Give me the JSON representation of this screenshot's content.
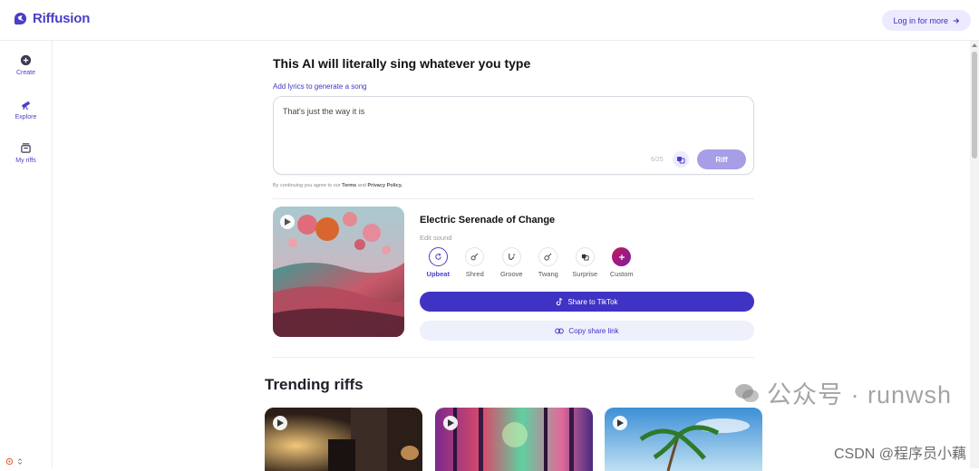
{
  "header": {
    "logo_text": "Riffusion",
    "login_label": "Log in for more"
  },
  "sidebar": {
    "items": [
      {
        "label": "Create",
        "icon": "plus-circle-icon"
      },
      {
        "label": "Explore",
        "icon": "telescope-icon"
      },
      {
        "label": "My riffs",
        "icon": "library-icon"
      }
    ]
  },
  "composer": {
    "headline": "This AI will literally sing whatever you type",
    "lyrics_label": "Add lyrics to generate a song",
    "lyrics_value": "That's just the way it is",
    "char_count": "6/25",
    "riff_label": "Riff",
    "terms_prefix": "By continuing you agree to our",
    "terms_link": "Terms",
    "terms_and": "and",
    "privacy_link": "Privacy Policy."
  },
  "result": {
    "song_title": "Electric Serenade of Change",
    "edit_sound_label": "Edit sound",
    "sounds": [
      {
        "label": "Upbeat",
        "icon": "refresh-icon",
        "active": true
      },
      {
        "label": "Shred",
        "icon": "guitar-icon"
      },
      {
        "label": "Groove",
        "icon": "saxophone-icon"
      },
      {
        "label": "Twang",
        "icon": "banjo-icon"
      },
      {
        "label": "Surprise",
        "icon": "dice-icon"
      },
      {
        "label": "Custom",
        "icon": "plus-icon"
      }
    ],
    "share_tiktok_label": "Share to TikTok",
    "copy_link_label": "Copy share link"
  },
  "trending": {
    "title": "Trending riffs"
  },
  "watermark": {
    "line1": "公众号 · runwsh",
    "line2": "CSDN @程序员小藕"
  },
  "colors": {
    "brand": "#4a3fc7",
    "riff_button": "#a69ee6",
    "tiktok_button": "#3f33c4",
    "copy_button_bg": "#eef0fc"
  }
}
